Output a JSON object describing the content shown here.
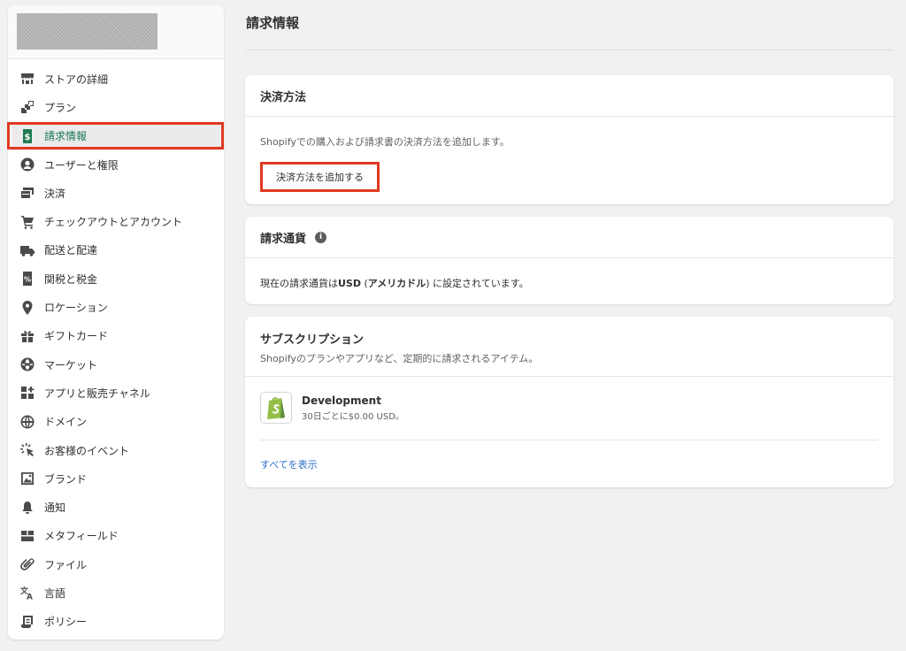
{
  "sidebar": {
    "items": [
      {
        "label": "ストアの詳細",
        "icon": "store-icon"
      },
      {
        "label": "プラン",
        "icon": "plan-icon"
      },
      {
        "label": "請求情報",
        "icon": "billing-icon",
        "active": true
      },
      {
        "label": "ユーザーと権限",
        "icon": "user-icon"
      },
      {
        "label": "決済",
        "icon": "payments-icon"
      },
      {
        "label": "チェックアウトとアカウント",
        "icon": "cart-icon"
      },
      {
        "label": "配送と配達",
        "icon": "truck-icon"
      },
      {
        "label": "関税と税金",
        "icon": "tax-icon"
      },
      {
        "label": "ロケーション",
        "icon": "location-icon"
      },
      {
        "label": "ギフトカード",
        "icon": "gift-icon"
      },
      {
        "label": "マーケット",
        "icon": "globe-icon"
      },
      {
        "label": "アプリと販売チャネル",
        "icon": "apps-icon"
      },
      {
        "label": "ドメイン",
        "icon": "domain-icon"
      },
      {
        "label": "お客様のイベント",
        "icon": "cursor-click-icon"
      },
      {
        "label": "ブランド",
        "icon": "brand-image-icon"
      },
      {
        "label": "通知",
        "icon": "bell-icon"
      },
      {
        "label": "メタフィールド",
        "icon": "metafields-icon"
      },
      {
        "label": "ファイル",
        "icon": "paperclip-icon"
      },
      {
        "label": "言語",
        "icon": "translate-icon"
      },
      {
        "label": "ポリシー",
        "icon": "policy-icon"
      }
    ]
  },
  "main": {
    "title": "請求情報",
    "payment_card": {
      "title": "決済方法",
      "description": "Shopifyでの購入および請求書の決済方法を追加します。",
      "button": "決済方法を追加する"
    },
    "currency_card": {
      "title": "請求通貨",
      "text_prefix": "現在の請求通貨は",
      "currency_code": "USD",
      "currency_name_open": " (",
      "currency_name": "アメリカドル",
      "currency_name_close": ")",
      "text_suffix": " に設定されています。"
    },
    "subscription_card": {
      "title": "サブスクリプション",
      "description": "Shopifyのプランやアプリなど、定期的に請求されるアイテム。",
      "item_name": "Development",
      "item_price": "30日ごとに$0.00 USD。",
      "view_all": "すべてを表示"
    }
  },
  "colors": {
    "accent_red": "#e03a22",
    "active_green": "#1a7a54",
    "link_blue": "#2c6ecb",
    "shopify_green": "#95bf47"
  }
}
